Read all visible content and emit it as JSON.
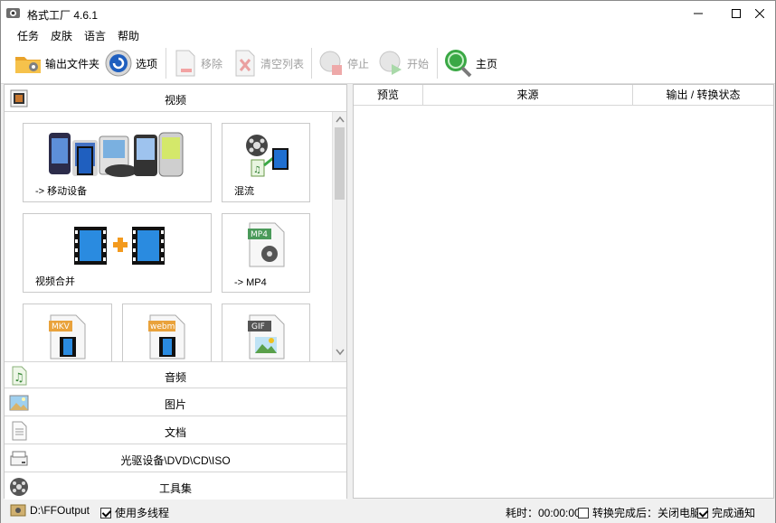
{
  "window": {
    "title": "格式工厂 4.6.1"
  },
  "menu": [
    "任务",
    "皮肤",
    "语言",
    "帮助"
  ],
  "toolbar": {
    "output_folder": "输出文件夹",
    "options": "选项",
    "remove": "移除",
    "clear_list": "清空列表",
    "stop": "停止",
    "start": "开始",
    "home": "主页"
  },
  "categories": {
    "video": "视频",
    "audio": "音频",
    "image": "图片",
    "document": "文档",
    "disc": "光驱设备\\DVD\\CD\\ISO",
    "tools": "工具集"
  },
  "video_tiles": {
    "mobile": "-> 移动设备",
    "mux": "混流",
    "merge": "视频合并",
    "mp4": "-> MP4",
    "mkv_badge": "MKV",
    "webm_badge": "webm",
    "gif_badge": "GIF",
    "mp4_badge": "MP4"
  },
  "table": {
    "columns": [
      "预览",
      "来源",
      "输出 / 转换状态"
    ]
  },
  "status": {
    "output_path": "D:\\FFOutput",
    "multithread": "使用多线程",
    "elapsed": "耗时：00:00:00",
    "after_convert": "转换完成后：关闭电脑",
    "notify": "完成通知"
  },
  "colors": {
    "accent_green": "#2e9b3a",
    "accent_orange": "#f39a1e",
    "film_blue": "#1f6fd1"
  }
}
